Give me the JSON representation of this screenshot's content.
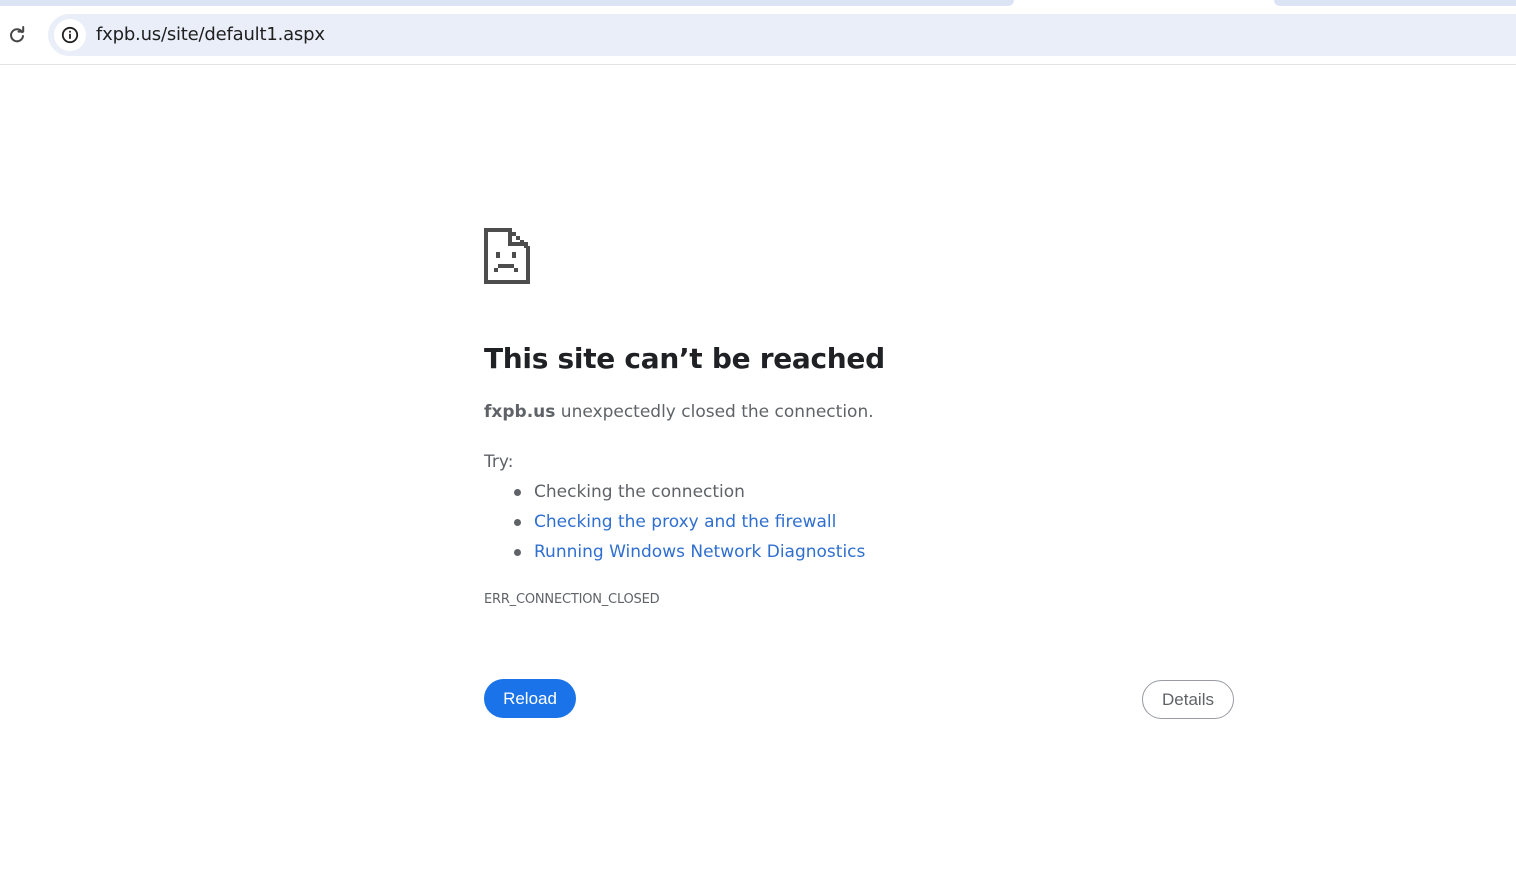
{
  "browser": {
    "url": "fxpb.us/site/default1.aspx",
    "icons": {
      "reload": "reload-icon",
      "site_info": "info-circle-icon"
    }
  },
  "error_page": {
    "icon": "sad-document-icon",
    "title": "This site can’t be reached",
    "host": "fxpb.us",
    "message": " unexpectedly closed the connection.",
    "try_label": "Try:",
    "suggestions": [
      {
        "text": "Checking the connection",
        "is_link": false
      },
      {
        "text": "Checking the proxy and the firewall",
        "is_link": true
      },
      {
        "text": "Running Windows Network Diagnostics",
        "is_link": true
      }
    ],
    "error_code": "ERR_CONNECTION_CLOSED",
    "reload_label": "Reload",
    "details_label": "Details"
  },
  "colors": {
    "primary_button": "#1a73e8",
    "link": "#2f6fcf",
    "text_secondary": "#5f6368",
    "omnibox_bg": "#e9eef8"
  }
}
